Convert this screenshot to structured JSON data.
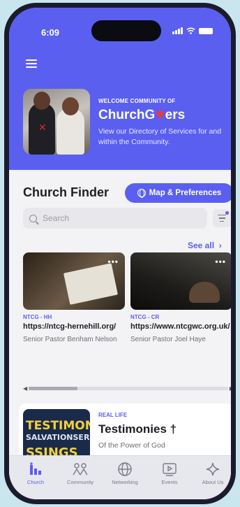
{
  "status_bar": {
    "time": "6:09"
  },
  "hero": {
    "welcome": "WELCOME COMMUNITY OF",
    "brand_before": "ChurchG",
    "brand_after": "ers",
    "description": "View our Directory of Services for and within the Community."
  },
  "finder": {
    "title": "Church Finder",
    "map_button": "Map & Preferences",
    "search_placeholder": "Search",
    "see_all": "See all",
    "see_all_chevron": "›"
  },
  "churches": [
    {
      "code": "NTCG - HH",
      "url": "https://ntcg-hernehill.org/",
      "pastor": "Senior Pastor Benham Nelson",
      "more": "•••"
    },
    {
      "code": "NTCG - CR",
      "url": "https://www.ntcgwc.org.uk/",
      "pastor": "Senior Pastor Joel Haye",
      "more": "•••"
    }
  ],
  "testimony": {
    "tag": "REAL LIFE",
    "title": "Testimonies †",
    "subtitle": "Of the Power of God",
    "image_words": [
      "TESTIMON",
      "SALVATIONSER",
      "SSINGS"
    ]
  },
  "tabs": [
    {
      "label": "Church",
      "icon": "church-icon",
      "active": true
    },
    {
      "label": "Community",
      "icon": "people-icon",
      "active": false
    },
    {
      "label": "Networking",
      "icon": "globe-icon",
      "active": false
    },
    {
      "label": "Events",
      "icon": "events-icon",
      "active": false
    },
    {
      "label": "About Us",
      "icon": "sparkle-icon",
      "active": false
    }
  ],
  "colors": {
    "accent": "#5a5ff0",
    "background": "#f3f3f6",
    "tabbar": "#e7e7ee"
  }
}
